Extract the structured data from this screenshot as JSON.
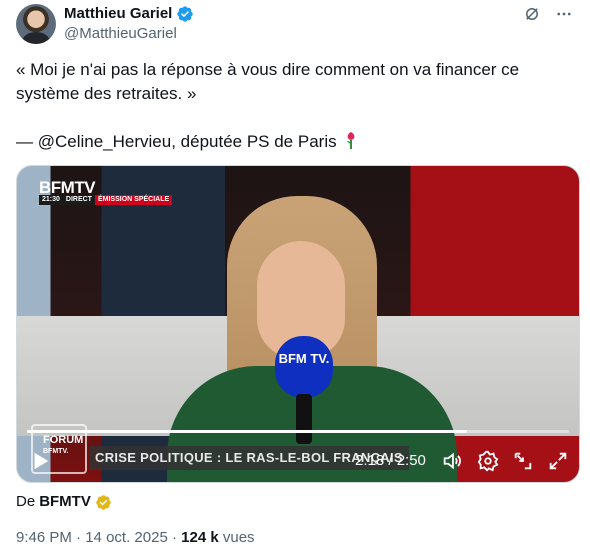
{
  "author": {
    "name": "Matthieu Gariel",
    "handle": "@MatthieuGariel"
  },
  "tweet": {
    "quote": "« Moi je n'ai pas la réponse à vous dire comment on va financer ce système des retraites. »",
    "attribution": "— @Celine_Hervieu, députée PS de Paris"
  },
  "video": {
    "channel_logo": "BFMTV",
    "bar_time": "21:30",
    "bar_live": "DIRECT",
    "bar_emission": "ÉMISSION SPÉCIALE",
    "show_logo_line1": "FORUM",
    "show_logo_line2": "BFMTV.",
    "headline": "CRISE POLITIQUE : LE RAS-LE-BOL FRANÇAIS",
    "mic_text": "BFM TV.",
    "time_display": "2:18 / 2:50",
    "progress_fraction": 0.8118
  },
  "source": {
    "prefix": "De",
    "org": "BFMTV"
  },
  "meta": {
    "time": "9:46 PM",
    "date": "14 oct. 2025",
    "views_count": "124 k",
    "views_label": "vues"
  },
  "colors": {
    "verified_blue": "#1d9bf0",
    "gold_badge": "#e2b719",
    "text_primary": "#0f1419",
    "text_secondary": "#536471"
  },
  "icons": [
    "verified-badge-icon",
    "grok-icon",
    "more-icon",
    "rose-icon",
    "play-icon",
    "volume-icon",
    "settings-icon",
    "minimize-icon",
    "fullscreen-icon",
    "gold-verified-icon"
  ]
}
